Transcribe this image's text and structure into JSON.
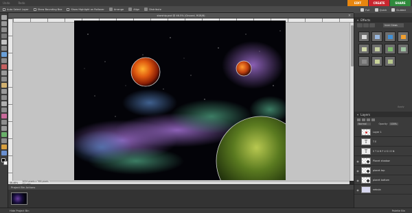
{
  "menubar": {
    "items": [
      "Undo",
      "Redo"
    ],
    "mode_tabs": [
      "EDIT",
      "CREATE",
      "SHARE"
    ]
  },
  "options": {
    "items": [
      "Auto Select Layer",
      "Show Bounding Box",
      "Show Highlight on Rollover",
      "Arrange",
      "Align",
      "Distribute"
    ]
  },
  "right_top": {
    "buttons": [
      "Full",
      "Quick",
      "Guided"
    ]
  },
  "document": {
    "title": "starship.psd @ 46.5% (Ground, RGB/8)",
    "status_zoom": "46.48%",
    "status_info": "1024 pixels x 768 pixels (72 ppi)"
  },
  "project_bin": {
    "title": "Project Bin Actions",
    "bottom_left": "Hide Project Bin",
    "bottom_right": "Palette Bin"
  },
  "effects": {
    "title": "Effects",
    "selected": "Inner Glows",
    "apply_label": "Apply",
    "swatches": [
      {
        "bg": "#6e6e6e",
        "fill": "#d9d9d9"
      },
      {
        "bg": "#6e6e6e",
        "fill": "#9ab8e0"
      },
      {
        "bg": "#6e6e6e",
        "fill": "#3f8fd6"
      },
      {
        "bg": "#6e6e6e",
        "fill": "#f2a030"
      },
      {
        "bg": "#6e6e6e",
        "fill": "#cfd7a8"
      },
      {
        "bg": "#6e6e6e",
        "fill": "#c5cfa0"
      },
      {
        "bg": "#6e6e6e",
        "fill": "#7dbb6a"
      },
      {
        "bg": "#6e6e6e",
        "fill": "#9fc2a2"
      },
      {
        "bg": "#6e6e6e",
        "fill": "#8a8a8a"
      },
      {
        "bg": "#6e6e6e",
        "fill": "#c9d49a"
      },
      {
        "bg": "#6e6e6e",
        "fill": "#b8c88d"
      }
    ]
  },
  "layers": {
    "title": "Layers",
    "blend": "Normal",
    "opacity_label": "Opacity:",
    "opacity_value": "100%",
    "items": [
      {
        "name": "Layer 1",
        "thumb": "checker"
      },
      {
        "name": "T E",
        "thumb": "text"
      },
      {
        "name": "S T A R  F U S I O N",
        "thumb": "text"
      },
      {
        "name": "Planet shadow",
        "thumb": "checker"
      },
      {
        "name": "planet top",
        "thumb": "checker"
      },
      {
        "name": "planet bottom",
        "thumb": "checker"
      },
      {
        "name": "nebula",
        "thumb": "plain"
      }
    ]
  },
  "colors": {
    "edit": "#e8860f",
    "create": "#c8252e",
    "share": "#2f8a3c"
  }
}
